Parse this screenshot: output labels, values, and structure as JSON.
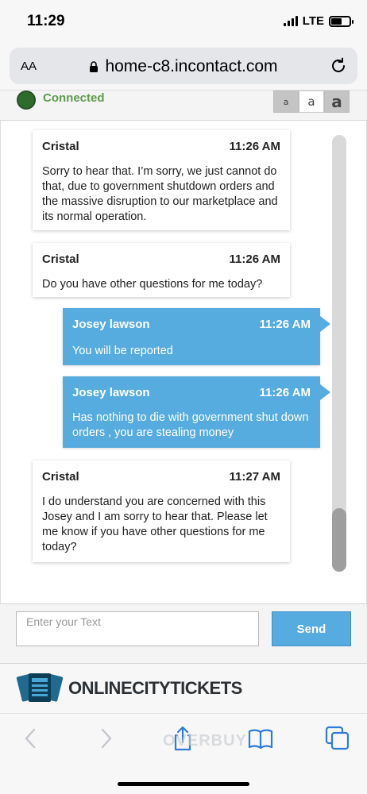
{
  "status_bar": {
    "time": "11:29",
    "network": "LTE",
    "icons": [
      "signal-icon",
      "battery-icon"
    ]
  },
  "browser": {
    "text_size_label": "AA",
    "url": "home-c8.incontact.com",
    "icons": [
      "lock-icon",
      "reload-icon"
    ]
  },
  "chat_header": {
    "status": "Connected",
    "status_color": "#2f6b2b",
    "font_sizes": [
      "a",
      "a",
      "a"
    ]
  },
  "messages": [
    {
      "sender": "Cristal",
      "time": "11:26 AM",
      "text": "Sorry to hear that. I’m sorry, we just cannot do that, due to government shutdown orders and the massive disruption to our marketplace and its normal operation.",
      "direction": "incoming"
    },
    {
      "sender": "Cristal",
      "time": "11:26 AM",
      "text": "Do you have other questions for me today?",
      "direction": "incoming"
    },
    {
      "sender": "Josey lawson",
      "time": "11:26 AM",
      "text": "You will be reported",
      "direction": "outgoing"
    },
    {
      "sender": "Josey lawson",
      "time": "11:26 AM",
      "text": "Has nothing to die with government shut down orders , you are stealing money",
      "direction": "outgoing"
    },
    {
      "sender": "Cristal",
      "time": "11:27 AM",
      "text": "I do understand you are concerned with this Josey and I am sorry to hear that. Please let me know if you have other questions for me today?",
      "direction": "incoming"
    }
  ],
  "composer": {
    "placeholder": "Enter your Text",
    "value": "",
    "send_label": "Send"
  },
  "brand": {
    "name": "ONLINECITYTICKETS"
  },
  "toolbar": {
    "icons": [
      "back-icon",
      "forward-icon",
      "share-icon",
      "bookmarks-icon",
      "tabs-icon"
    ],
    "watermark": "OVERBUY"
  },
  "colors": {
    "accent": "#56abdf",
    "connected_label": "#5f9a4c"
  }
}
